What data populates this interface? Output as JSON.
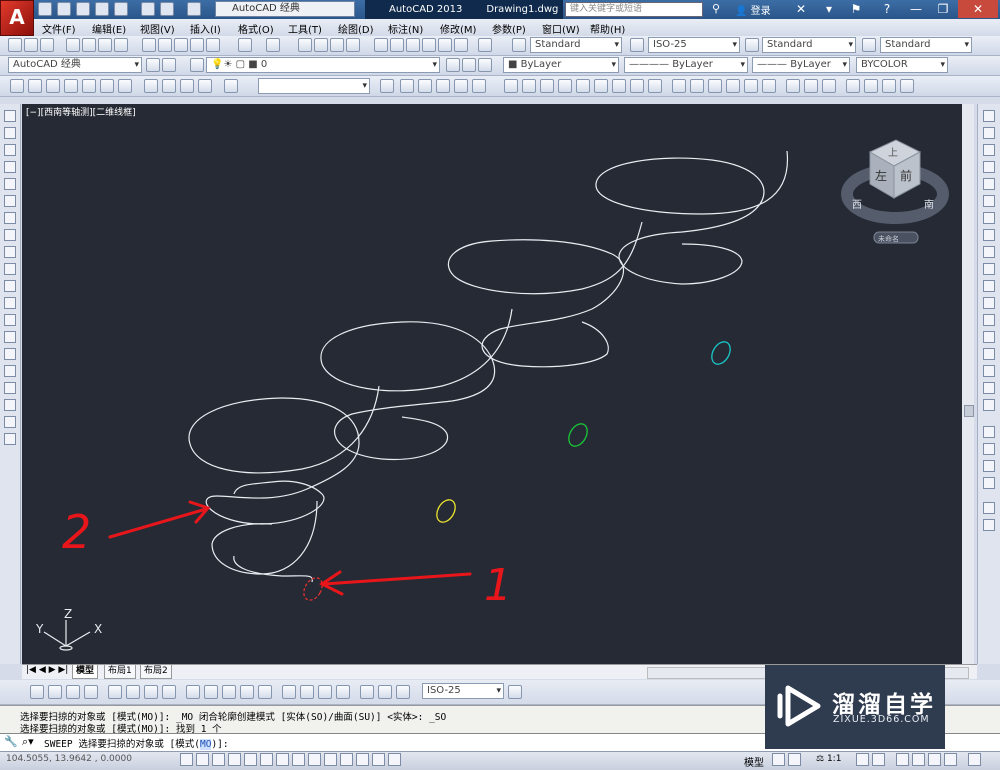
{
  "app": {
    "logo_letter": "A",
    "workspace": "AutoCAD 经典",
    "title": "AutoCAD 2013",
    "document": "Drawing1.dwg",
    "search_placeholder": "键入关键字或短语",
    "login": "登录"
  },
  "menu": [
    "文件(F)",
    "编辑(E)",
    "视图(V)",
    "插入(I)",
    "格式(O)",
    "工具(T)",
    "绘图(D)",
    "标注(N)",
    "修改(M)",
    "参数(P)",
    "窗口(W)",
    "帮助(H)"
  ],
  "styles": {
    "text_style": "Standard",
    "dim_style": "ISO-25",
    "table_style": "Standard",
    "multileader_style": "Standard"
  },
  "layers": {
    "workspace": "AutoCAD 经典",
    "current_layer": "0",
    "color": "ByLayer",
    "linetype": "ByLayer",
    "lineweight": "ByLayer",
    "plotstyle": "BYCOLOR"
  },
  "viewport": {
    "label": "[−][西南等轴测][二维线框]",
    "viewcube": {
      "top": "上",
      "left": "左",
      "front": "前",
      "south": "南",
      "west": "西",
      "unnamed": "未命名"
    }
  },
  "annotations": {
    "label1": "1",
    "label2": "2",
    "color": "#e8161b"
  },
  "ucs": {
    "x": "X",
    "y": "Y",
    "z": "Z"
  },
  "layout_tabs": [
    "模型",
    "布局1",
    "布局2"
  ],
  "dim_toolbar": {
    "dim_style": "ISO-25"
  },
  "command": {
    "history": [
      "选择要扫掠的对象或 [模式(MO)]: _MO 闭合轮廓创建模式 [实体(SO)/曲面(SU)] <实体>: _SO",
      "选择要扫掠的对象或 [模式(MO)]: 找到 1 个"
    ],
    "prompt_prefix": "SWEEP 选择要扫掠的对象或 [模式(",
    "prompt_keyword": "MO",
    "prompt_suffix": ")]:"
  },
  "status": {
    "coords": "104.5055, 13.9642 , 0.0000",
    "model": "模型",
    "scale": "1:1"
  },
  "watermark": {
    "brand": "溜溜自学",
    "url": "ZIXUE.3D66.COM"
  }
}
